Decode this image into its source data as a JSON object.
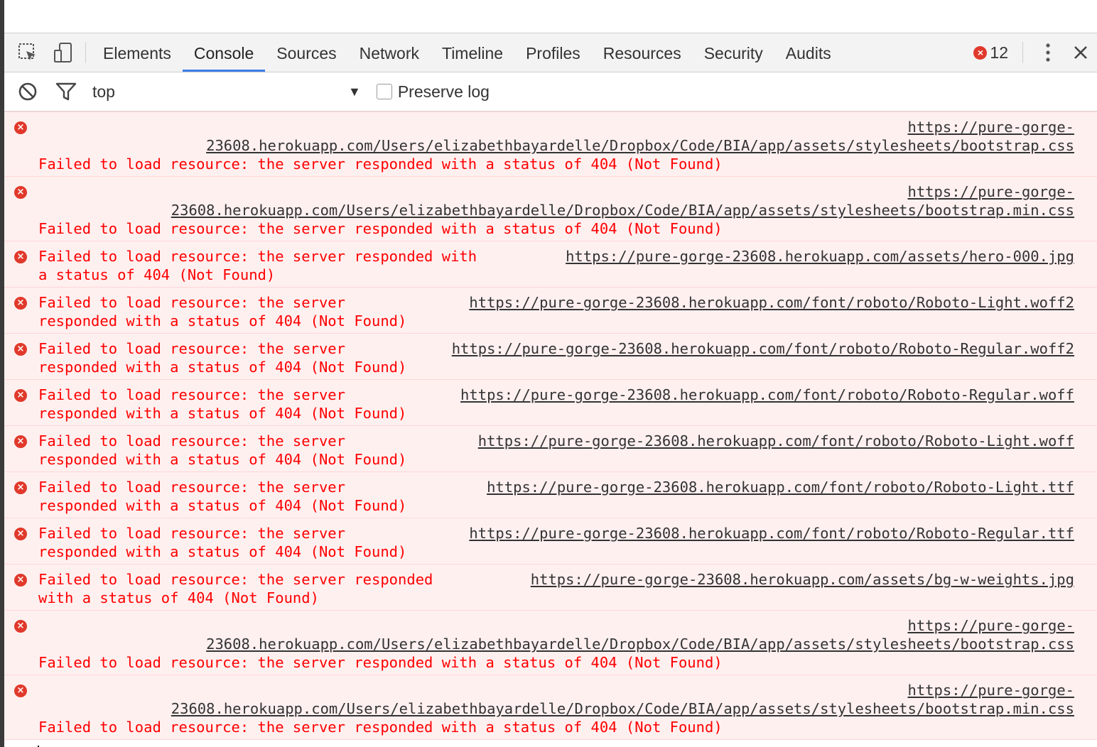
{
  "toolbar_tabs": [
    "Elements",
    "Console",
    "Sources",
    "Network",
    "Timeline",
    "Profiles",
    "Resources",
    "Security",
    "Audits"
  ],
  "active_tab": "Console",
  "error_count": "12",
  "filter": {
    "context": "top",
    "preserve_log_label": "Preserve log"
  },
  "messages": [
    {
      "layout": "stacked",
      "url1": "https://pure-gorge-",
      "url2": "23608.herokuapp.com/Users/elizabethbayardelle/Dropbox/Code/BIA/app/assets/stylesheets/bootstrap.css",
      "text": "Failed to load resource: the server responded with a status of 404 (Not Found)"
    },
    {
      "layout": "stacked",
      "url1": "https://pure-gorge-",
      "url2": "23608.herokuapp.com/Users/elizabethbayardelle/Dropbox/Code/BIA/app/assets/stylesheets/bootstrap.min.css",
      "text": "Failed to load resource: the server responded with a status of 404 (Not Found)"
    },
    {
      "layout": "inline",
      "text1": "Failed to load resource: the server responded with",
      "url": "https://pure-gorge-23608.herokuapp.com/assets/hero-000.jpg",
      "text2": "a status of 404 (Not Found)"
    },
    {
      "layout": "inline",
      "text1": "Failed to load resource: the server",
      "url": "https://pure-gorge-23608.herokuapp.com/font/roboto/Roboto-Light.woff2",
      "text2": "responded with a status of 404 (Not Found)"
    },
    {
      "layout": "inline",
      "text1": "Failed to load resource: the server",
      "url": "https://pure-gorge-23608.herokuapp.com/font/roboto/Roboto-Regular.woff2",
      "text2": "responded with a status of 404 (Not Found)"
    },
    {
      "layout": "inline",
      "text1": "Failed to load resource: the server",
      "url": "https://pure-gorge-23608.herokuapp.com/font/roboto/Roboto-Regular.woff",
      "text2": "responded with a status of 404 (Not Found)"
    },
    {
      "layout": "inline",
      "text1": "Failed to load resource: the server",
      "url": "https://pure-gorge-23608.herokuapp.com/font/roboto/Roboto-Light.woff",
      "text2": "responded with a status of 404 (Not Found)"
    },
    {
      "layout": "inline",
      "text1": "Failed to load resource: the server",
      "url": "https://pure-gorge-23608.herokuapp.com/font/roboto/Roboto-Light.ttf",
      "text2": "responded with a status of 404 (Not Found)"
    },
    {
      "layout": "inline",
      "text1": "Failed to load resource: the server",
      "url": "https://pure-gorge-23608.herokuapp.com/font/roboto/Roboto-Regular.ttf",
      "text2": "responded with a status of 404 (Not Found)"
    },
    {
      "layout": "inline",
      "text1": "Failed to load resource: the server responded",
      "url": "https://pure-gorge-23608.herokuapp.com/assets/bg-w-weights.jpg",
      "text2": "with a status of 404 (Not Found)"
    },
    {
      "layout": "stacked",
      "url1": "https://pure-gorge-",
      "url2": "23608.herokuapp.com/Users/elizabethbayardelle/Dropbox/Code/BIA/app/assets/stylesheets/bootstrap.css",
      "text": "Failed to load resource: the server responded with a status of 404 (Not Found)"
    },
    {
      "layout": "stacked",
      "url1": "https://pure-gorge-",
      "url2": "23608.herokuapp.com/Users/elizabethbayardelle/Dropbox/Code/BIA/app/assets/stylesheets/bootstrap.min.css",
      "text": "Failed to load resource: the server responded with a status of 404 (Not Found)"
    }
  ],
  "colors": {
    "error_text": "#ff0000",
    "error_bg": "#fff0f0",
    "accent": "#3b7de8"
  }
}
